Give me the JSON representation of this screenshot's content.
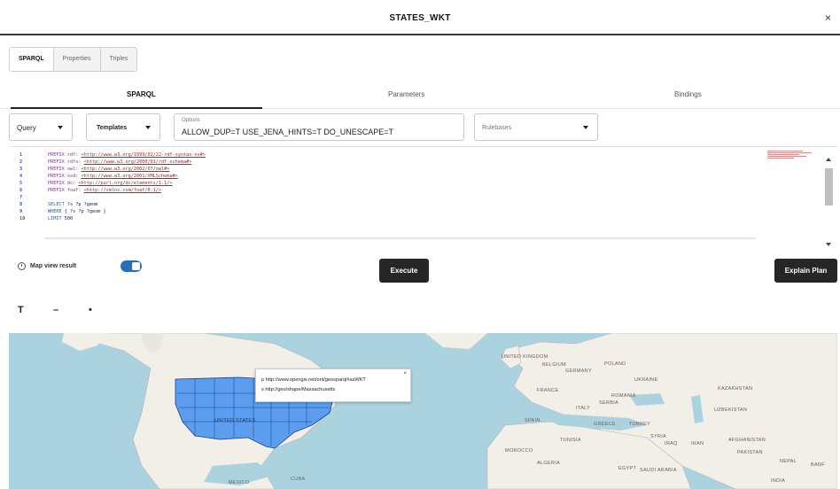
{
  "window": {
    "title": "STATES_WKT",
    "close_label": "×"
  },
  "top_tabs": [
    {
      "label": "SPARQL",
      "active": true
    },
    {
      "label": "Properties",
      "active": false
    },
    {
      "label": "Triples",
      "active": false
    }
  ],
  "sub_tabs": [
    {
      "label": "SPARQL",
      "active": true
    },
    {
      "label": "Parameters",
      "active": false
    },
    {
      "label": "Bindings",
      "active": false
    }
  ],
  "controls": {
    "query_select": "Query",
    "templates_button": "Templates",
    "options_caption": "Options",
    "options_value": "ALLOW_DUP=T USE_JENA_HINTS=T DO_UNESCAPE=T",
    "rulebases_placeholder": "Rulebases"
  },
  "editor": {
    "lines": [
      {
        "n": "1",
        "kw": "PREFIX rdf:",
        "url": "<http://www.w3.org/1999/02/22-rdf-syntax-ns#>"
      },
      {
        "n": "2",
        "kw": "PREFIX rdfs:",
        "url": "<http://www.w3.org/2000/01/rdf-schema#>"
      },
      {
        "n": "3",
        "kw": "PREFIX owl:",
        "url": "<http://www.w3.org/2002/07/owl#>"
      },
      {
        "n": "4",
        "kw": "PREFIX xsd:",
        "url": "<http://www.w3.org/2001/XMLSchema#>"
      },
      {
        "n": "5",
        "kw": "PREFIX dc:",
        "url": "<http://purl.org/dc/elements/1.1/>"
      },
      {
        "n": "6",
        "kw": "PREFIX foaf:",
        "url": "<http://xmlns.com/foaf/0.1/>"
      },
      {
        "n": "7",
        "kw": "",
        "url": ""
      },
      {
        "n": "8",
        "kw": "SELECT",
        "plain": "?s ?p ?geom"
      },
      {
        "n": "9",
        "kw": "WHERE",
        "plain": "{ ?s ?p ?geom }"
      },
      {
        "n": "10",
        "kw": "LIMIT",
        "plain": "500"
      }
    ]
  },
  "execute_row": {
    "map_view_label": "Map view result",
    "map_view_enabled": true,
    "execute_label": "Execute",
    "explain_label": "Explain Plan"
  },
  "map_toolbar": {
    "filter_icon": "T",
    "zoom_out": "–",
    "dot": "•"
  },
  "map": {
    "popup_line1": "p http://www.opengis.net/ont/geosparql#asWKT",
    "popup_line2": "s http://geo/shape/Massachusetts",
    "popup_close": "×",
    "labels": {
      "uk": "UNITED KINGDOM",
      "belgium": "BELGIUM",
      "germany": "GERMANY",
      "poland": "POLAND",
      "ukraine": "UKRAINE",
      "france": "FRANCE",
      "romania": "ROMANIA",
      "serbia": "SERBIA",
      "kazakhstan": "KAZAKHSTAN",
      "italy": "ITALY",
      "uzbekistan": "UZBEKISTAN",
      "spain": "SPAIN",
      "greece": "GREECE",
      "turkey": "TURKEY",
      "syria": "SYRIA",
      "iraq": "IRAQ",
      "iran": "IRAN",
      "afghanistan": "AFGHANISTAN",
      "tunisia": "TUNISIA",
      "pakistan": "PAKISTAN",
      "morocco": "MOROCCO",
      "nepal": "NEPAL",
      "algeria": "ALGERIA",
      "egypt": "EGYPT",
      "saudi": "SAUDI ARABIA",
      "india": "INDIA",
      "usa": "UNITED STATES",
      "mexico": "MEXICO",
      "cuba": "CUBA",
      "banf": "BANF"
    }
  }
}
